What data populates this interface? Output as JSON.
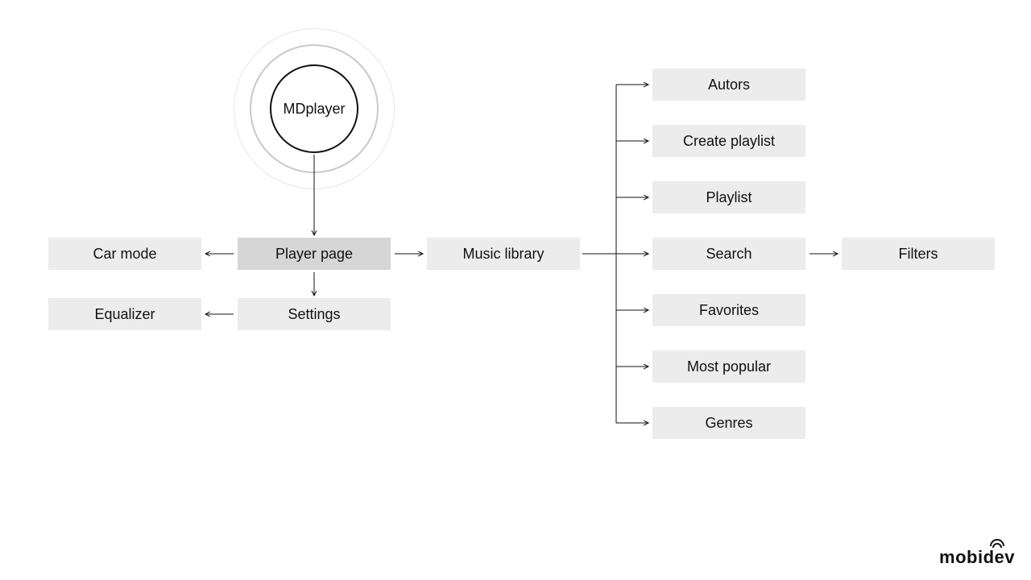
{
  "root": {
    "label": "MDplayer"
  },
  "nodes": {
    "car_mode": "Car mode",
    "player_page": "Player page",
    "music_library": "Music library",
    "equalizer": "Equalizer",
    "settings": "Settings",
    "autors": "Autors",
    "create_playlist": "Create playlist",
    "playlist": "Playlist",
    "search": "Search",
    "favorites": "Favorites",
    "most_popular": "Most popular",
    "genres": "Genres",
    "filters": "Filters"
  },
  "logo": "mobidev"
}
